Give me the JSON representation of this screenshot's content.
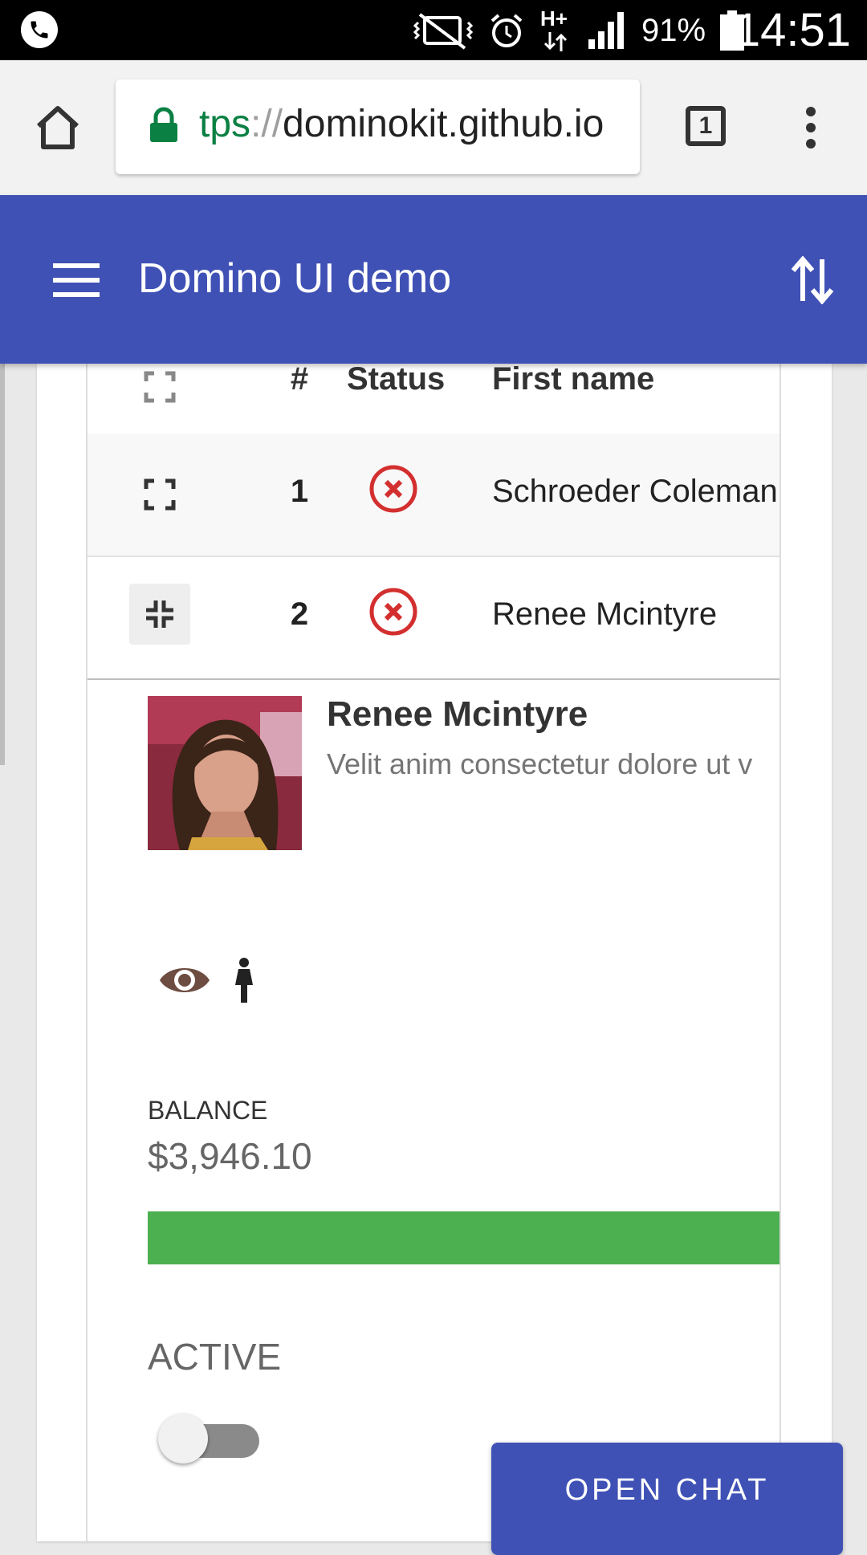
{
  "status_bar": {
    "battery_percent": "91%",
    "time": "14:51",
    "network_type": "H+",
    "icons": [
      "phone-icon",
      "mute-vibrate-icon",
      "alarm-icon",
      "network-hplus-icon",
      "signal-icon",
      "battery-icon"
    ]
  },
  "browser": {
    "url_scheme": "tps",
    "url_sep": "://",
    "url_host": "dominokit.github.io",
    "tab_count": "1"
  },
  "app": {
    "title": "Domino UI demo",
    "primary_color": "#3f51b5"
  },
  "table": {
    "columns": [
      "#",
      "Status",
      "First name"
    ],
    "rows": [
      {
        "num": "1",
        "status": "inactive",
        "first_name": "Schroeder Coleman",
        "expanded": false
      },
      {
        "num": "2",
        "status": "inactive",
        "first_name": "Renee Mcintyre",
        "expanded": true
      }
    ]
  },
  "detail": {
    "name": "Renee Mcintyre",
    "description": "Velit anim consectetur dolore ut v",
    "icons": [
      "eye-icon",
      "female-icon"
    ],
    "balance_label": "BALANCE",
    "balance_value": "$3,946.10",
    "balance_progress_percent": 100,
    "progress_color": "#4caf50",
    "active_label": "ACTIVE",
    "active": false
  },
  "chat_button": {
    "label": "OPEN CHAT"
  }
}
